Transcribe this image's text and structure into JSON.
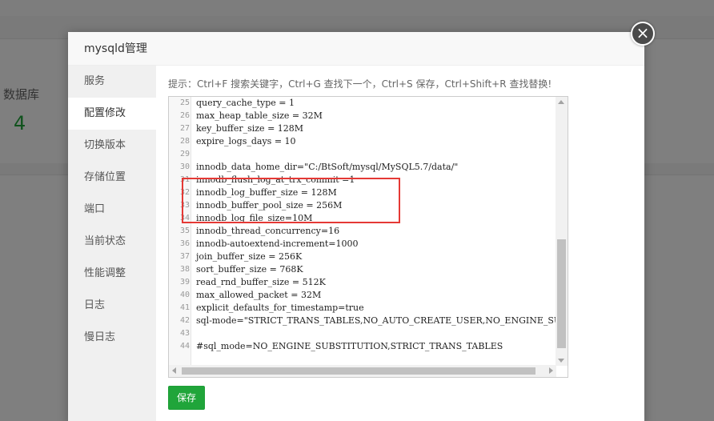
{
  "background": {
    "db_label": "数据库",
    "db_count": "4"
  },
  "modal": {
    "title": "mysqld管理",
    "close_glyph": "×"
  },
  "sidebar": {
    "items": [
      {
        "label": "服务"
      },
      {
        "label": "配置修改"
      },
      {
        "label": "切换版本"
      },
      {
        "label": "存储位置"
      },
      {
        "label": "端口"
      },
      {
        "label": "当前状态"
      },
      {
        "label": "性能调整"
      },
      {
        "label": "日志"
      },
      {
        "label": "慢日志"
      }
    ],
    "active_index": 1
  },
  "content": {
    "tip": "提示：Ctrl+F 搜索关键字，Ctrl+G 查找下一个，Ctrl+S 保存，Ctrl+Shift+R 查找替换!",
    "save_label": "保存"
  },
  "editor": {
    "lines": [
      {
        "n": "25",
        "text": "query_cache_type = 1"
      },
      {
        "n": "26",
        "text": "max_heap_table_size = 32M"
      },
      {
        "n": "27",
        "text": "key_buffer_size = 128M"
      },
      {
        "n": "28",
        "text": "expire_logs_days = 10"
      },
      {
        "n": "29",
        "text": ""
      },
      {
        "n": "30",
        "text": "innodb_data_home_dir=\"C:/BtSoft/mysql/MySQL5.7/data/\""
      },
      {
        "n": "31",
        "text": "innodb_flush_log_at_trx_commit =1"
      },
      {
        "n": "32",
        "text": "innodb_log_buffer_size = 128M"
      },
      {
        "n": "33",
        "text": "innodb_buffer_pool_size = 256M"
      },
      {
        "n": "34",
        "text": "innodb_log_file_size=10M"
      },
      {
        "n": "35",
        "text": "innodb_thread_concurrency=16"
      },
      {
        "n": "36",
        "text": "innodb-autoextend-increment=1000"
      },
      {
        "n": "37",
        "text": "join_buffer_size = 256K"
      },
      {
        "n": "38",
        "text": "sort_buffer_size = 768K"
      },
      {
        "n": "39",
        "text": "read_rnd_buffer_size = 512K"
      },
      {
        "n": "40",
        "text": "max_allowed_packet = 32M"
      },
      {
        "n": "41",
        "text": "explicit_defaults_for_timestamp=true"
      },
      {
        "n": "42",
        "text": "sql-mode=\"STRICT_TRANS_TABLES,NO_AUTO_CREATE_USER,NO_ENGINE_SUBSTITUTION\""
      },
      {
        "n": "43",
        "text": ""
      },
      {
        "n": "44",
        "text": "#sql_mode=NO_ENGINE_SUBSTITUTION,STRICT_TRANS_TABLES"
      }
    ]
  },
  "colors": {
    "accent": "#20a53a",
    "highlight": "#e53935"
  }
}
